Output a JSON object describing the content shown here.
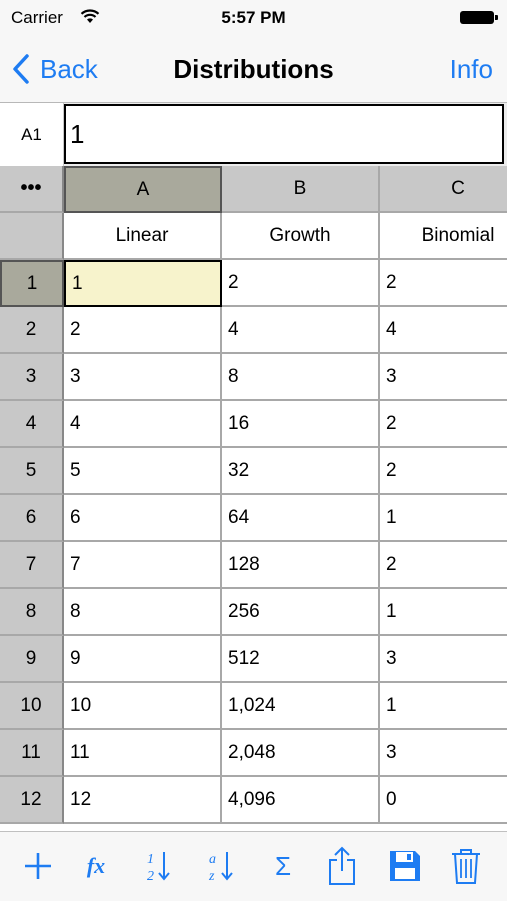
{
  "status_bar": {
    "carrier": "Carrier",
    "time": "5:57 PM"
  },
  "nav": {
    "back_label": "Back",
    "title": "Distributions",
    "info_label": "Info"
  },
  "formula_bar": {
    "cell_ref": "A1",
    "value": "1"
  },
  "sheet": {
    "corner_label": "•••",
    "columns": [
      "A",
      "B",
      "C"
    ],
    "column_names": [
      "Linear",
      "Growth",
      "Binomial"
    ],
    "rows": [
      {
        "num": "1",
        "a": "1",
        "b": "2",
        "c": "2"
      },
      {
        "num": "2",
        "a": "2",
        "b": "4",
        "c": "4"
      },
      {
        "num": "3",
        "a": "3",
        "b": "8",
        "c": "3"
      },
      {
        "num": "4",
        "a": "4",
        "b": "16",
        "c": "2"
      },
      {
        "num": "5",
        "a": "5",
        "b": "32",
        "c": "2"
      },
      {
        "num": "6",
        "a": "6",
        "b": "64",
        "c": "1"
      },
      {
        "num": "7",
        "a": "7",
        "b": "128",
        "c": "2"
      },
      {
        "num": "8",
        "a": "8",
        "b": "256",
        "c": "1"
      },
      {
        "num": "9",
        "a": "9",
        "b": "512",
        "c": "3"
      },
      {
        "num": "10",
        "a": "10",
        "b": "1,024",
        "c": "1"
      },
      {
        "num": "11",
        "a": "11",
        "b": "2,048",
        "c": "3"
      },
      {
        "num": "12",
        "a": "12",
        "b": "4,096",
        "c": "0"
      }
    ]
  },
  "toolbar": {
    "icons": [
      "add-icon",
      "function-icon",
      "sort-numeric-icon",
      "sort-alpha-icon",
      "sum-icon",
      "share-icon",
      "save-icon",
      "trash-icon"
    ]
  },
  "colors": {
    "accent": "#1e7cf2",
    "selected_cell": "#f7f3cc",
    "header": "#c8c8c8",
    "selected_header": "#a9a99c"
  }
}
